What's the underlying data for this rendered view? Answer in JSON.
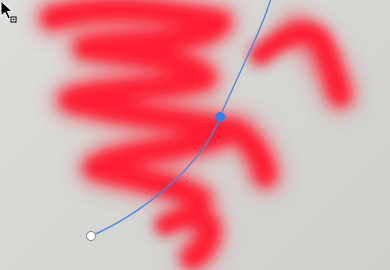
{
  "canvas": {
    "background_color": "#d8d8d4",
    "brush_color": "#ff1f33",
    "path_color": "#4a86e0",
    "anchor_selected_color": "#2f7fe8",
    "anchor_endpoint_color": "#ffffff"
  },
  "tool": {
    "active_tool": "pen",
    "cursor_icon": "pen-cursor-with-square-icon"
  }
}
